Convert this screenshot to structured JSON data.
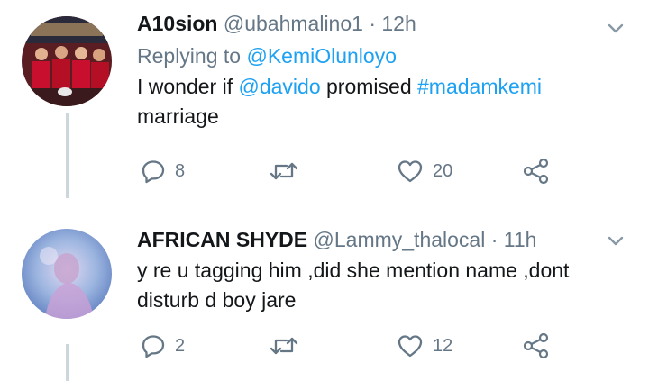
{
  "tweets": [
    {
      "display_name": "A10sion",
      "handle": "@ubahmalino1",
      "separator": "·",
      "time": "12h",
      "replying_label": "Replying to",
      "replying_handle": "@KemiOlunloyo",
      "text_parts": {
        "p1": "I wonder if ",
        "mention": "@davido",
        "p2": " promised ",
        "hashtag": "#madamkemi",
        "p3": "marriage"
      },
      "replies": "8",
      "retweets": "",
      "likes": "20"
    },
    {
      "display_name": "AFRICAN SHYDE",
      "handle": "@Lammy_thalocal",
      "separator": "·",
      "time": "11h",
      "text_parts": {
        "line1": "y re u tagging him ,did she mention name ,dont",
        "line2": "disturb d boy jare"
      },
      "replies": "2",
      "retweets": "",
      "likes": "12"
    }
  ],
  "colors": {
    "text": "#14171a",
    "secondary": "#657786",
    "link": "#1da1f2",
    "thread_line": "#ccd6dd"
  },
  "icons": [
    "reply-icon",
    "retweet-icon",
    "like-icon",
    "share-icon",
    "chevron-down-icon"
  ]
}
